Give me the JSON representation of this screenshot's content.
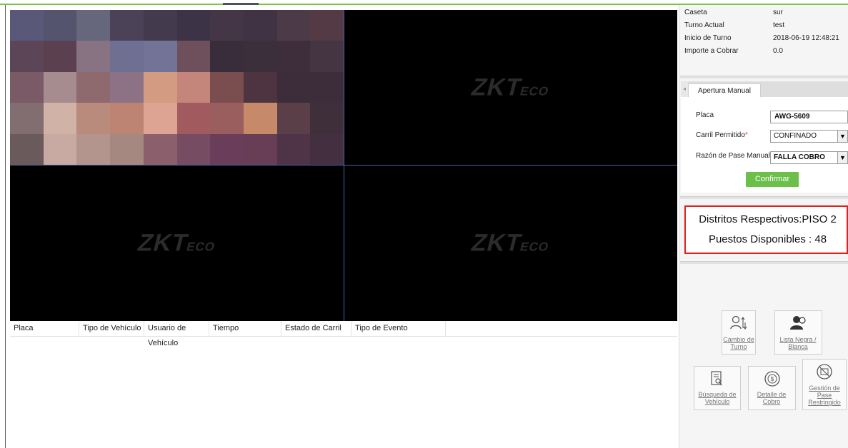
{
  "info": {
    "rows": [
      {
        "label": "Caseta",
        "value": "sur"
      },
      {
        "label": "Turno Actual",
        "value": "test"
      },
      {
        "label": "Inicio de Turno",
        "value": "2018-06-19 12:48:21"
      },
      {
        "label": "Importe a Cobrar",
        "value": "0.0"
      }
    ]
  },
  "video": {
    "watermark_main": "ZKT",
    "watermark_suffix": "ECO"
  },
  "table": {
    "columns": [
      "Placa",
      "Tipo de Vehículo",
      "Usuario de Vehículo",
      "Tiempo",
      "Estado de Carril",
      "Tipo de Evento"
    ]
  },
  "manual_open": {
    "tab_label": "Apertura Manual",
    "fields": {
      "placa_label": "Placa",
      "placa_value": "AWG-5609",
      "carril_label": "Carril Permitido",
      "carril_required_mark": "*",
      "carril_value": "CONFINADO",
      "razon_label": "Razón de Pase Manual",
      "razon_value": "FALLA COBRO"
    },
    "confirm_label": "Confirmar"
  },
  "district": {
    "line1": "Distritos Respectivos:PISO 2",
    "line2": "Puestos Disponibles : 48"
  },
  "actions": {
    "cambio_turno": "Cambio de Turno",
    "lista_negra": "Lista Negra / Blanca",
    "busqueda": "Búsqueda de Vehículo",
    "detalle_cobro": "Detalle de Cobro",
    "gestion_pase": "Gestión de Pase Restringido"
  },
  "colors": {
    "accent_green": "#6cc04a",
    "top_line": "#7cc24a",
    "alert_red": "#e0201e"
  }
}
